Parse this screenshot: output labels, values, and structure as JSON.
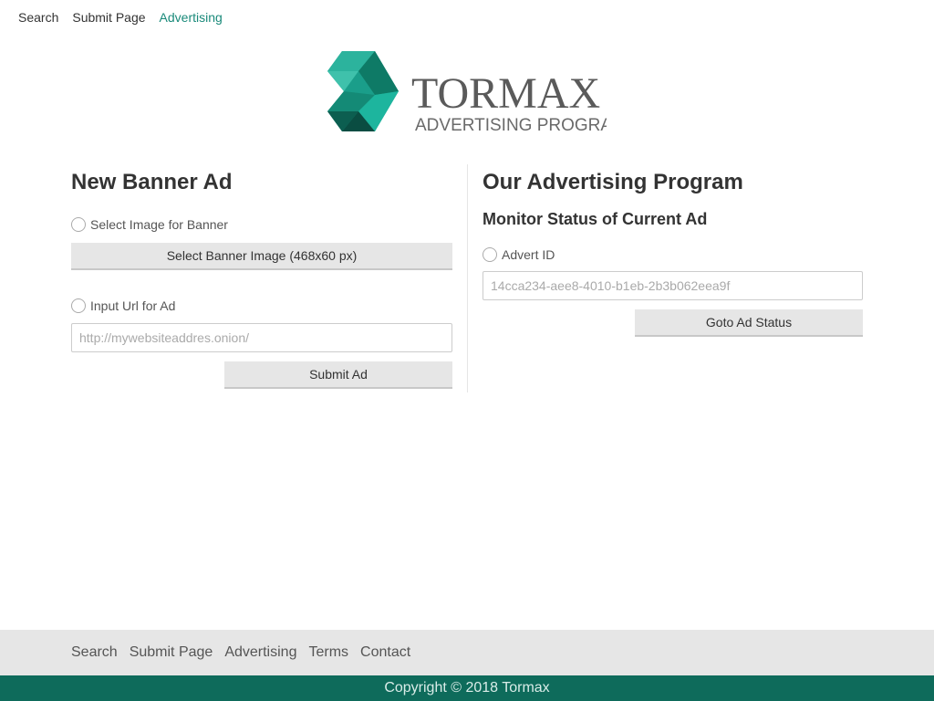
{
  "nav": {
    "items": [
      {
        "label": "Search"
      },
      {
        "label": "Submit Page"
      },
      {
        "label": "Advertising"
      }
    ]
  },
  "logo": {
    "name": "TORMAX",
    "tagline": "ADVERTISING PROGRAM",
    "colors": {
      "teal": "#1a9e8a",
      "teal_dark": "#0e6b5b",
      "text": "#5a5a5a"
    }
  },
  "left": {
    "heading": "New Banner Ad",
    "image_option_label": "Select Image for Banner",
    "select_image_button": "Select Banner Image (468x60 px)",
    "url_option_label": "Input Url for Ad",
    "url_placeholder": "http://mywebsiteaddres.onion/",
    "submit_button": "Submit Ad"
  },
  "right": {
    "heading": "Our Advertising Program",
    "subheading": "Monitor Status of Current Ad",
    "advert_option_label": "Advert ID",
    "advert_placeholder": "14cca234-aee8-4010-b1eb-2b3b062eea9f",
    "goto_button": "Goto Ad Status"
  },
  "footer": {
    "links": [
      {
        "label": "Search"
      },
      {
        "label": "Submit Page"
      },
      {
        "label": "Advertising"
      },
      {
        "label": "Terms"
      },
      {
        "label": "Contact"
      }
    ],
    "copyright": "Copyright © 2018 Tormax"
  },
  "colors": {
    "accent": "#1a8a7a",
    "footer_bar": "#0e6b5b",
    "footer_links_bg": "#e6e6e6",
    "button_bg": "#e6e6e6"
  }
}
